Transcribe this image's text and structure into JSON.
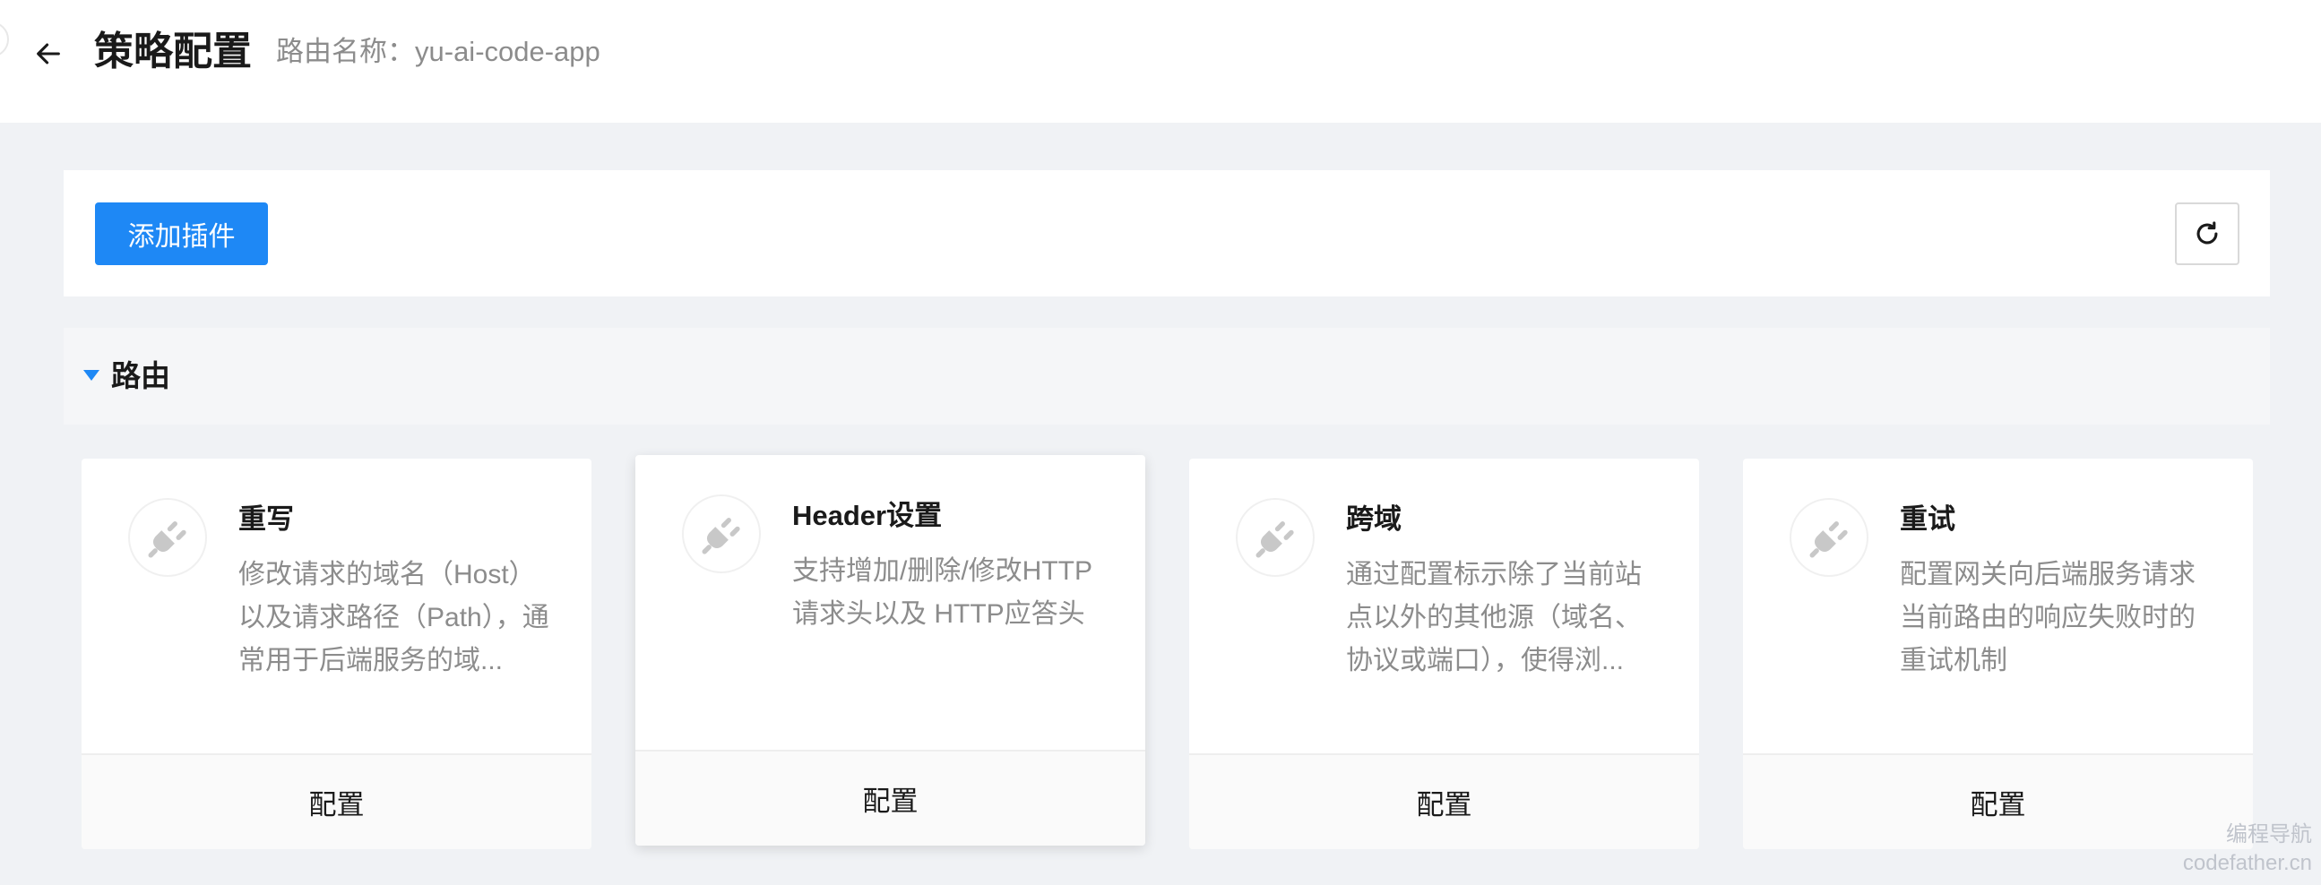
{
  "header": {
    "title": "策略配置",
    "route_name": "路由名称：yu-ai-code-app"
  },
  "toolbar": {
    "add_plugin_label": "添加插件"
  },
  "section": {
    "title": "路由"
  },
  "cards": [
    {
      "title": "重写",
      "description": "修改请求的域名（Host）以及请求路径（Path），通常用于后端服务的域...",
      "action": "配置"
    },
    {
      "title": "Header设置",
      "description": "支持增加/删除/修改HTTP 请求头以及 HTTP应答头",
      "action": "配置"
    },
    {
      "title": "跨域",
      "description": "通过配置标示除了当前站点以外的其他源（域名、协议或端口），使得浏...",
      "action": "配置"
    },
    {
      "title": "重试",
      "description": "配置网关向后端服务请求当前路由的响应失败时的重试机制",
      "action": "配置"
    }
  ],
  "watermark": {
    "line1": "编程导航",
    "line2": "codefather.cn"
  },
  "colors": {
    "primary": "#1e88f5",
    "background": "#f0f2f5"
  },
  "icons": {
    "back": "arrow-left-icon",
    "refresh": "refresh-icon",
    "plugin": "plug-icon",
    "section_toggle": "caret-down-icon"
  }
}
